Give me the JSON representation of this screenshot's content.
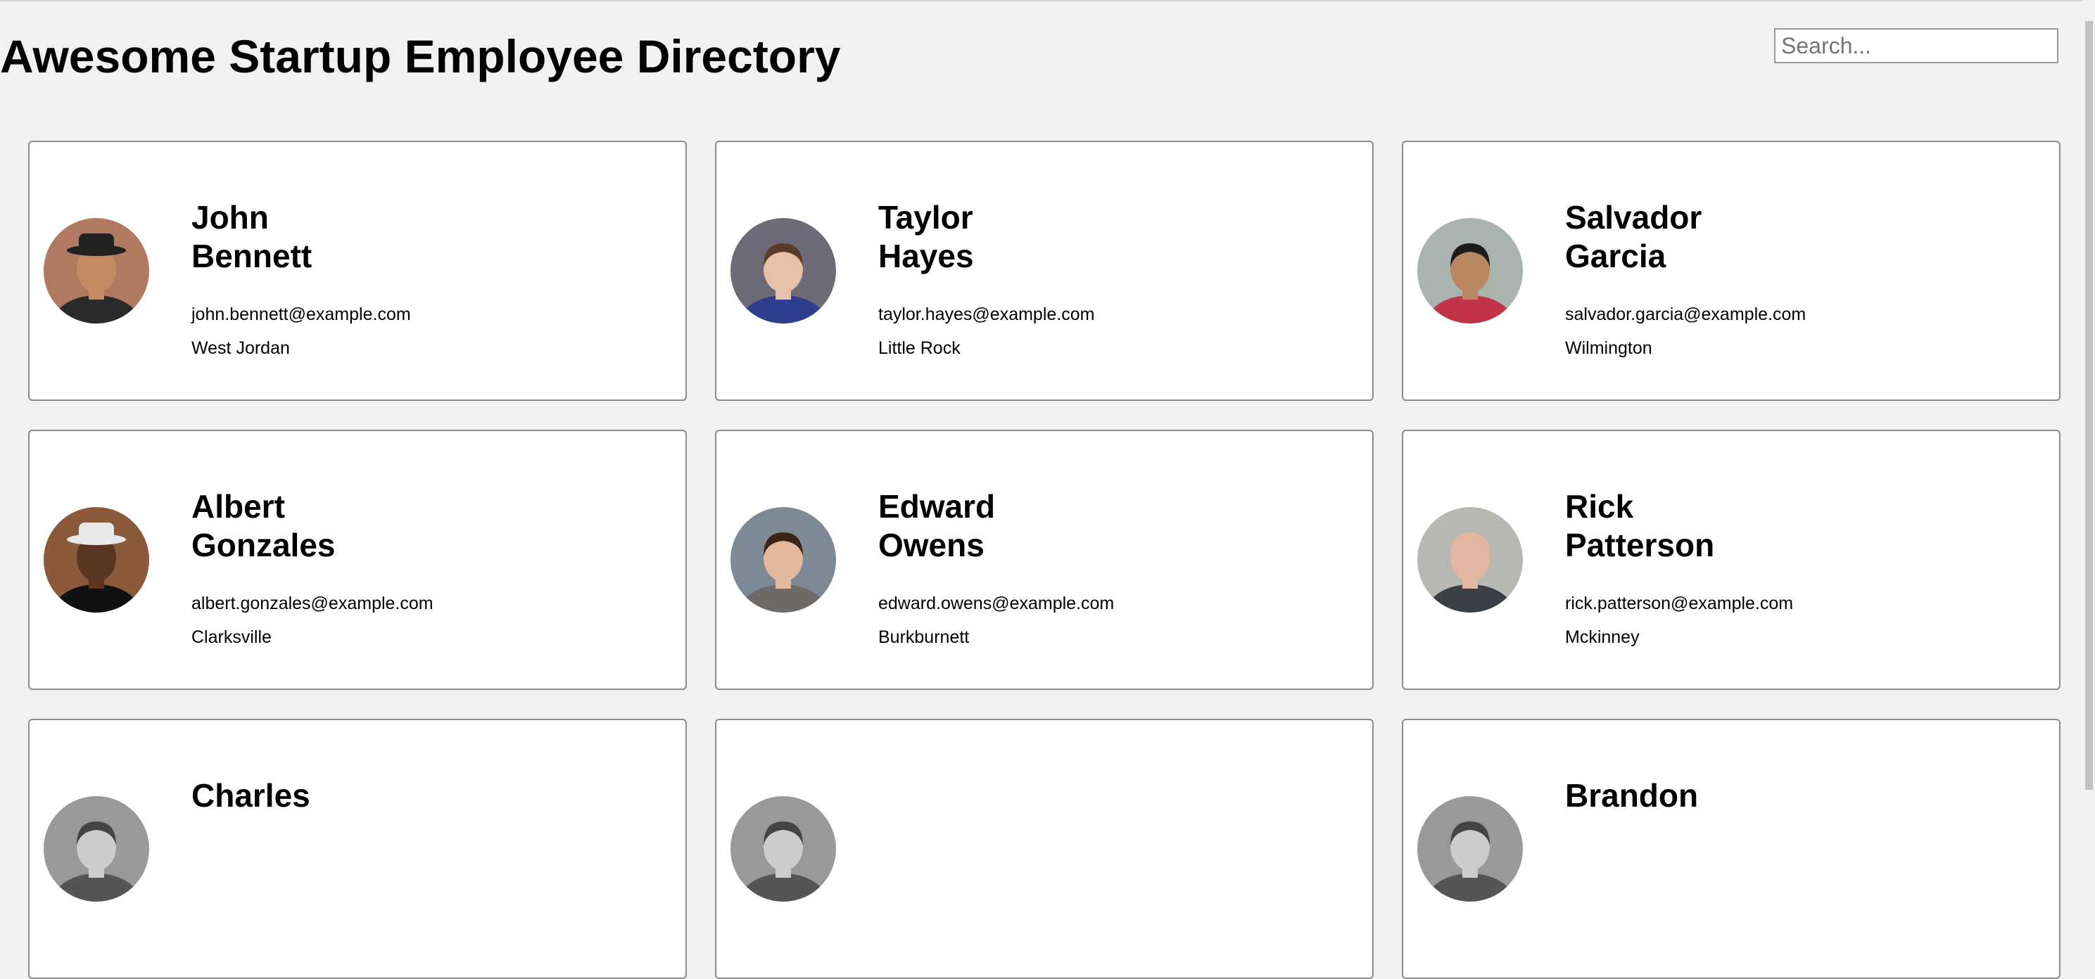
{
  "header": {
    "title": "Awesome Startup Employee Directory",
    "search_placeholder": "Search..."
  },
  "employees": [
    {
      "first": "John",
      "last": "Bennett",
      "email": "john.bennett@example.com",
      "location": "West Jordan",
      "avatar_bg": "#b07a60",
      "skin": "#c48a62",
      "hair": "#222222",
      "shirt": "#2a2a2a",
      "hat": true
    },
    {
      "first": "Taylor",
      "last": "Hayes",
      "email": "taylor.hayes@example.com",
      "location": "Little Rock",
      "avatar_bg": "#6e6b78",
      "skin": "#e6c1a8",
      "hair": "#5a3b28",
      "shirt": "#2c3e8c",
      "hat": false
    },
    {
      "first": "Salvador",
      "last": "Garcia",
      "email": "salvador.garcia@example.com",
      "location": "Wilmington",
      "avatar_bg": "#a9b4ae",
      "skin": "#b98762",
      "hair": "#1c1c1c",
      "shirt": "#c2334a",
      "hat": false
    },
    {
      "first": "Albert",
      "last": "Gonzales",
      "email": "albert.gonzales@example.com",
      "location": "Clarksville",
      "avatar_bg": "#8a5a3a",
      "skin": "#5a3620",
      "hair": "#e8e8e8",
      "shirt": "#111111",
      "hat": true
    },
    {
      "first": "Edward",
      "last": "Owens",
      "email": "edward.owens@example.com",
      "location": "Burkburnett",
      "avatar_bg": "#7d8a95",
      "skin": "#e2b99b",
      "hair": "#3b2518",
      "shirt": "#6e6a68",
      "hat": false
    },
    {
      "first": "Rick",
      "last": "Patterson",
      "email": "rick.patterson@example.com",
      "location": "Mckinney",
      "avatar_bg": "#b8b8b3",
      "skin": "#e2b6a0",
      "hair": "#e2b6a0",
      "shirt": "#3a3f45",
      "hat": false
    },
    {
      "first": "Charles",
      "last": "",
      "email": "",
      "location": "",
      "avatar_bg": "#999999",
      "skin": "#cccccc",
      "hair": "#444444",
      "shirt": "#555555",
      "hat": false
    },
    {
      "first": "",
      "last": "",
      "email": "",
      "location": "",
      "avatar_bg": "#999999",
      "skin": "#cccccc",
      "hair": "#444444",
      "shirt": "#555555",
      "hat": false
    },
    {
      "first": "Brandon",
      "last": "",
      "email": "",
      "location": "",
      "avatar_bg": "#999999",
      "skin": "#cccccc",
      "hair": "#444444",
      "shirt": "#555555",
      "hat": false
    }
  ]
}
